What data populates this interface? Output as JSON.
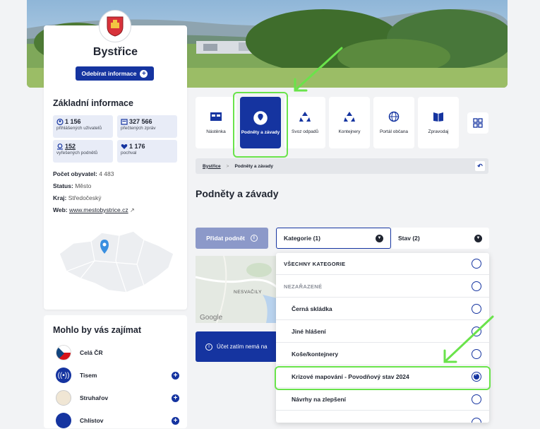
{
  "city": {
    "name": "Bystřice",
    "follow_label": "Odebírat informace"
  },
  "basic_info": {
    "heading": "Základní informace",
    "stats": [
      {
        "value": "1 156",
        "label": "přihlášených uživatelů",
        "icon": "user-icon"
      },
      {
        "value": "327 566",
        "label": "přečtených zpráv",
        "icon": "news-icon"
      },
      {
        "value": "152",
        "label": "vyřešených podnětů",
        "icon": "pin-icon"
      },
      {
        "value": "1 176",
        "label": "pochval",
        "icon": "heart-icon"
      }
    ],
    "population_label": "Počet obyvatel:",
    "population_value": "4 483",
    "status_label": "Status:",
    "status_value": "Město",
    "region_label": "Kraj:",
    "region_value": "Středočeský",
    "web_label": "Web:",
    "web_value": "www.mestobystrice.cz"
  },
  "suggest": {
    "heading": "Mohlo by vás zajímat",
    "items": [
      {
        "name": "Celá ČR"
      },
      {
        "name": "Tisem"
      },
      {
        "name": "Struhařov"
      },
      {
        "name": "Chlístov"
      }
    ]
  },
  "tiles": [
    {
      "label": "Nástěnka",
      "icon": "board-icon"
    },
    {
      "label": "Podněty a závady",
      "icon": "report-pin-icon",
      "active": true
    },
    {
      "label": "Svoz odpadů",
      "icon": "recycle-icon"
    },
    {
      "label": "Kontejnery",
      "icon": "recycle-icon"
    },
    {
      "label": "Portál občana",
      "icon": "globe-icon"
    },
    {
      "label": "Zpravodaj",
      "icon": "newspaper-icon"
    }
  ],
  "breadcrumb": {
    "home": "Bystřice",
    "current": "Podněty a závady"
  },
  "page_title": "Podněty a závady",
  "toolbar": {
    "add_label": "Přidat podnět",
    "category_label": "Kategorie (1)",
    "state_label": "Stav (2)"
  },
  "map": {
    "place_label": "NESVAČILY",
    "google_label": "Google"
  },
  "notice": {
    "text": "Účet zatím nemá na"
  },
  "dropdown": {
    "items": [
      {
        "label": "VŠECHNY KATEGORIE",
        "checked": false
      },
      {
        "label": "NEZAŘAZENÉ",
        "checked": false
      },
      {
        "label": "Černá skládka",
        "checked": false
      },
      {
        "label": "Jiné hlášení",
        "checked": false
      },
      {
        "label": "Koše/kontejnery",
        "checked": false
      },
      {
        "label": "Krizové mapování - Povodňový stav 2024",
        "checked": true
      },
      {
        "label": "Návrhy na zlepšení",
        "checked": false
      }
    ]
  },
  "colors": {
    "primary": "#1534a0",
    "highlight": "#6ae34b"
  }
}
